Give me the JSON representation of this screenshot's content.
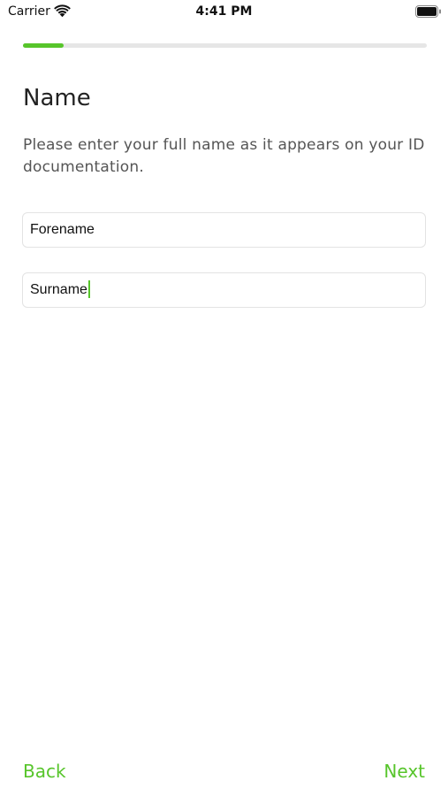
{
  "status_bar": {
    "carrier": "Carrier",
    "time": "4:41 PM",
    "wifi_icon": "wifi-icon",
    "battery_icon": "battery-icon"
  },
  "progress": {
    "fraction": 0.1,
    "accent_color": "#57c52b",
    "track_color": "#e6e6e6"
  },
  "page": {
    "title": "Name",
    "description": "Please enter your full name as it appears on your ID documentation."
  },
  "form": {
    "forename": {
      "value": "",
      "placeholder": "Forename"
    },
    "surname": {
      "value": "",
      "placeholder": "Surname",
      "focused": true
    }
  },
  "nav": {
    "back_label": "Back",
    "next_label": "Next"
  }
}
